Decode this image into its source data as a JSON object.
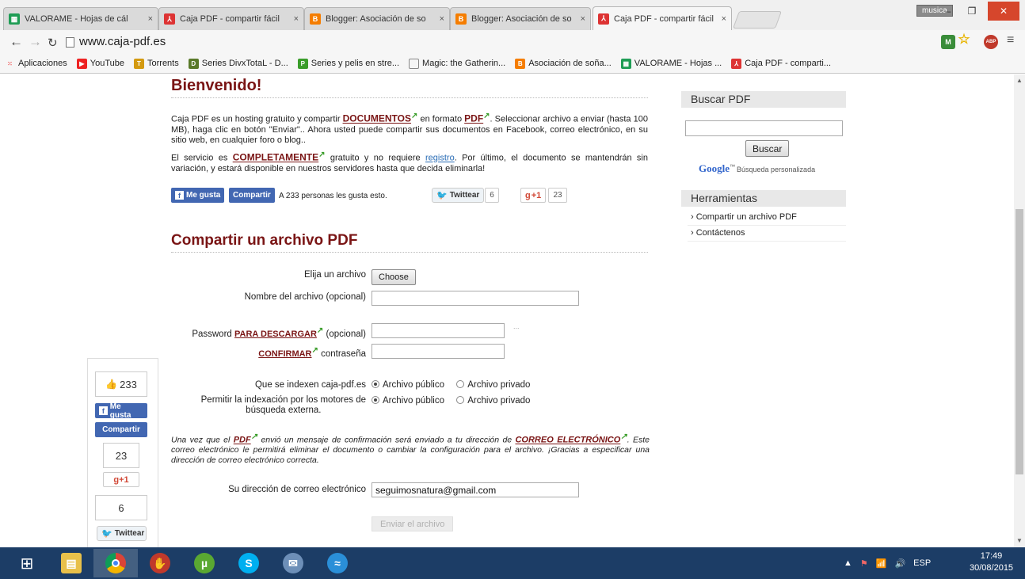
{
  "browser": {
    "tabs": [
      {
        "title": "VALORAME - Hojas de cál",
        "icon": "sheets-icon"
      },
      {
        "title": "Caja PDF - compartir fácil",
        "icon": "pdf-icon"
      },
      {
        "title": "Blogger: Asociación de so",
        "icon": "blogger-icon"
      },
      {
        "title": "Blogger: Asociación de so",
        "icon": "blogger-icon"
      },
      {
        "title": "Caja PDF - compartir fácil",
        "icon": "pdf-icon",
        "active": true
      }
    ],
    "tab_close": "×",
    "user_badge": "musica",
    "url": "www.caja-pdf.es",
    "ext_m": "M",
    "ext_abp": "ABP",
    "bookmarks": [
      {
        "label": "Aplicaciones",
        "icon": "apps-icon"
      },
      {
        "label": "YouTube",
        "icon": "youtube-icon"
      },
      {
        "label": "Torrents",
        "icon": "torrents-icon"
      },
      {
        "label": "Series DivxTotaL - D...",
        "icon": "divx-icon"
      },
      {
        "label": "Series y pelis en stre...",
        "icon": "series-icon"
      },
      {
        "label": "Magic: the Gatherin...",
        "icon": "page-icon"
      },
      {
        "label": "Asociación de soña...",
        "icon": "blogger-icon"
      },
      {
        "label": "VALORAME - Hojas ...",
        "icon": "sheets-icon"
      },
      {
        "label": "Caja PDF - comparti...",
        "icon": "pdf-icon"
      }
    ]
  },
  "welcome": {
    "heading": "Bienvenido!",
    "p1_a": "Caja PDF es un hosting gratuito y compartir ",
    "p1_link1": "DOCUMENTOS",
    "p1_b": " en formato ",
    "p1_link2": "PDF",
    "p1_c": ". Seleccionar archivo a enviar (hasta 100 MB), haga clic en botón \"Enviar\".. Ahora usted puede compartir sus documentos en Facebook, correo electrónico, en su sitio web, en cualquier foro o blog..",
    "p2_a": "El servicio es ",
    "p2_link1": "COMPLETAMENTE",
    "p2_b": " gratuito y no requiere ",
    "p2_link2": "registro",
    "p2_c": ". Por último, el documento se mantendrán sin variación, y estará disponible en nuestros servidores hasta que decida eliminarla!"
  },
  "social": {
    "fb_like": "Me gusta",
    "fb_share": "Compartir",
    "fb_count_text": "A 233 personas les gusta esto.",
    "tweet": "Twittear",
    "tweet_count": "6",
    "gplus": "+1",
    "gplus_count": "23"
  },
  "form": {
    "heading": "Compartir un archivo PDF",
    "choose_label": "Elija un archivo",
    "choose_button": "Choose",
    "filename_label": "Nombre del archivo (opcional)",
    "filename_value": "",
    "password_a": "Password ",
    "password_link": "PARA DESCARGAR",
    "password_b": " (opcional)",
    "password_dots": "...",
    "confirm_link": "CONFIRMAR",
    "confirm_b": " contraseña",
    "index_label": "Que se indexen caja-pdf.es",
    "engine_label_1": "Permitir la indexación por los motores de",
    "engine_label_2": "búsqueda externa.",
    "opt_public": "Archivo público",
    "opt_private": "Archivo privado",
    "note_a": "Una vez que el ",
    "note_link1": "PDF",
    "note_b": " envió un mensaje de confirmación será enviado a tu dirección de ",
    "note_link2": "CORREO ELECTRÓNICO",
    "note_c": ". Este correo electrónico le permitirá eliminar el documento o cambiar la configuración para el archivo. ¡Gracias a especificar una dirección de correo electrónico correcta.",
    "email_label": "Su dirección de correo electrónico",
    "email_value": "seguimosnatura@gmail.com",
    "submit": "Enviar el archivo"
  },
  "sidebar": {
    "search_heading": "Buscar PDF",
    "search_button": "Buscar",
    "google_logo": "Google",
    "google_tm": "™",
    "google_custom": "Búsqueda personalizada",
    "tools_heading": "Herramientas",
    "tools": [
      "Compartir un archivo PDF",
      "Contáctenos"
    ]
  },
  "floatbox": {
    "likes": "233",
    "like_btn": "Me gusta",
    "share_btn": "Compartir",
    "gplus_count": "23",
    "gplus_btn": "+1",
    "tweet_count": "6",
    "tweet_btn": "Twittear"
  },
  "taskbar": {
    "lang": "ESP",
    "time": "17:49",
    "date": "30/08/2015"
  }
}
